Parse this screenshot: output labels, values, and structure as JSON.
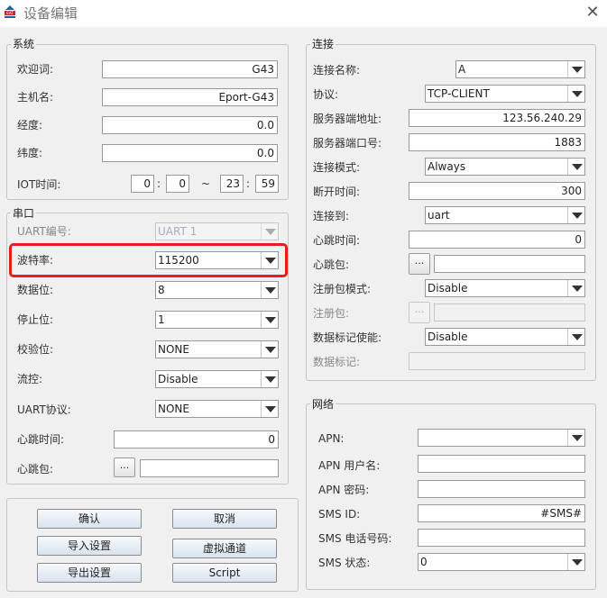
{
  "window": {
    "title": "设备编辑",
    "icon_text": "EAT",
    "close_glyph": "✕"
  },
  "system": {
    "title": "系统",
    "welcome": {
      "label": "欢迎词:",
      "value": "G43"
    },
    "hostname": {
      "label": "主机名:",
      "value": "Eport-G43"
    },
    "longitude": {
      "label": "经度:",
      "value": "0.0"
    },
    "latitude": {
      "label": "纬度:",
      "value": "0.0"
    },
    "iot_time": {
      "label": "IOT时间:",
      "start_hour": "0",
      "start_minute": "0",
      "end_hour": "23",
      "end_minute": "59",
      "colon": ":",
      "tilde": "~"
    }
  },
  "serial": {
    "title": "串口",
    "uart_no": {
      "label": "UART编号:",
      "value": "UART 1"
    },
    "baud": {
      "label": "波特率:",
      "value": "115200"
    },
    "data_bits": {
      "label": "数据位:",
      "value": "8"
    },
    "stop_bits": {
      "label": "停止位:",
      "value": "1"
    },
    "parity": {
      "label": "校验位:",
      "value": "NONE"
    },
    "flow": {
      "label": "流控:",
      "value": "Disable"
    },
    "uart_protocol": {
      "label": "UART协议:",
      "value": "NONE"
    },
    "heartbeat_time": {
      "label": "心跳时间:",
      "value": "0"
    },
    "heartbeat_pkt": {
      "label": "心跳包:",
      "button": "...",
      "value": ""
    }
  },
  "buttons": {
    "confirm": "确认",
    "cancel": "取消",
    "import": "导入设置",
    "virtual_channel": "虚拟通道",
    "export": "导出设置",
    "script": "Script"
  },
  "connection": {
    "title": "连接",
    "name": {
      "label": "连接名称:",
      "value": "A"
    },
    "protocol": {
      "label": "协议:",
      "value": "TCP-CLIENT"
    },
    "server_addr": {
      "label": "服务器端地址:",
      "value": "123.56.240.29"
    },
    "server_port": {
      "label": "服务器端口号:",
      "value": "1883"
    },
    "conn_mode": {
      "label": "连接模式:",
      "value": "Always"
    },
    "disconnect_time": {
      "label": "断开时间:",
      "value": "300"
    },
    "connect_to": {
      "label": "连接到:",
      "value": "uart"
    },
    "heartbeat_time": {
      "label": "心跳时间:",
      "value": "0"
    },
    "heartbeat_pkt": {
      "label": "心跳包:",
      "button": "...",
      "value": ""
    },
    "register_mode": {
      "label": "注册包模式:",
      "value": "Disable"
    },
    "register_pkt": {
      "label": "注册包:",
      "button": "...",
      "value": ""
    },
    "data_tag_enable": {
      "label": "数据标记使能:",
      "value": "Disable"
    },
    "data_tag": {
      "label": "数据标记:",
      "value": ""
    }
  },
  "network": {
    "title": "网络",
    "apn": {
      "label": "APN:",
      "value": ""
    },
    "apn_user": {
      "label": "APN 用户名:",
      "value": ""
    },
    "apn_password": {
      "label": "APN 密码:",
      "value": ""
    },
    "sms_id": {
      "label": "SMS ID:",
      "value": "#SMS#"
    },
    "sms_phone": {
      "label": "SMS 电话号码:",
      "value": ""
    },
    "sms_status": {
      "label": "SMS 状态:",
      "value": "0"
    }
  },
  "colors": {
    "highlight": "#e81c1c",
    "background": "#f0f0f0"
  }
}
